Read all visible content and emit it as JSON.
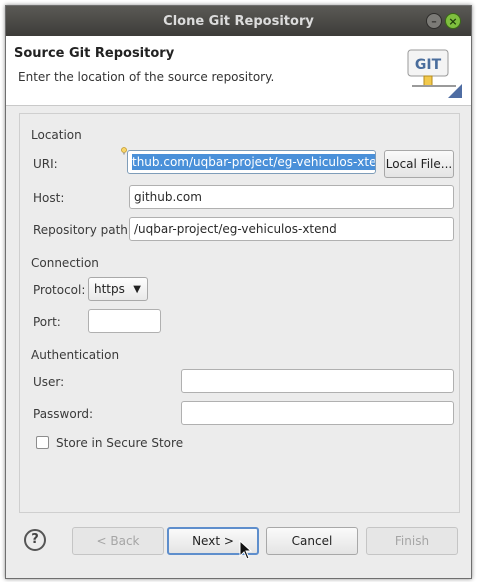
{
  "window": {
    "title": "Clone Git Repository"
  },
  "banner": {
    "title": "Source Git Repository",
    "description": "Enter the location of the source repository.",
    "logo_text": "GIT"
  },
  "location": {
    "section_label": "Location",
    "uri_label": "URI:",
    "uri_value": "thub.com/uqbar-project/eg-vehiculos-xtend",
    "local_file_button": "Local File...",
    "host_label": "Host:",
    "host_value": "github.com",
    "repo_path_label": "Repository path:",
    "repo_path_value": "/uqbar-project/eg-vehiculos-xtend"
  },
  "connection": {
    "section_label": "Connection",
    "protocol_label": "Protocol:",
    "protocol_value": "https",
    "port_label": "Port:",
    "port_value": ""
  },
  "authentication": {
    "section_label": "Authentication",
    "user_label": "User:",
    "user_value": "",
    "password_label": "Password:",
    "password_value": "",
    "secure_store_label": "Store in Secure Store",
    "secure_store_checked": false
  },
  "buttons": {
    "help": "?",
    "back": "< Back",
    "next": "Next >",
    "cancel": "Cancel",
    "finish": "Finish"
  },
  "colors": {
    "selection": "#4a90d9",
    "default_button_border": "#5e8ecc",
    "close_button": "#7fbf3f"
  }
}
